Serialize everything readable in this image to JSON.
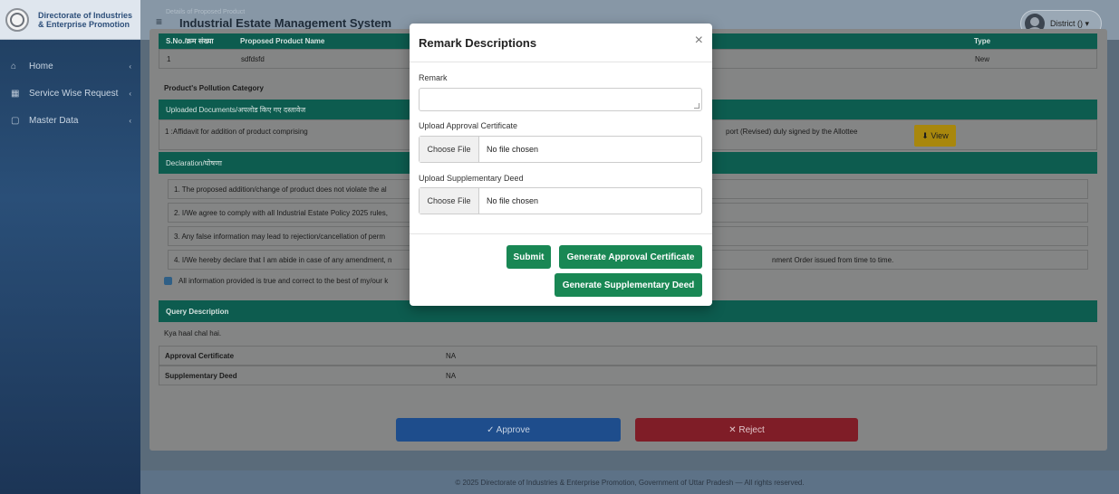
{
  "sidebar": {
    "brand_line1": "Directorate of Industries",
    "brand_line2": "& Enterprise Promotion",
    "items": [
      {
        "label": "Home",
        "icon": "home-icon"
      },
      {
        "label": "Service Wise Request",
        "icon": "list-icon"
      },
      {
        "label": "Master Data",
        "icon": "file-icon"
      }
    ]
  },
  "header": {
    "title": "Industrial Estate Management System",
    "faint_subtitle": "Details of Proposed Product",
    "user": "District () ▾"
  },
  "page": {
    "product_table": {
      "headers": [
        "S.No./क्रम संख्या",
        "Proposed Product Name",
        "Type"
      ],
      "row": [
        "1",
        "sdfdsfd",
        "New"
      ]
    },
    "pollution_label": "Product's Pollution Category",
    "uploaded_docs_header": "Uploaded Documents/अपलोड किए गए दस्तावेज",
    "doc_1": "1 :Affidavit for addition of product comprising",
    "doc_2": "port (Revised) duly signed by the Allottee",
    "view_label": "View",
    "declaration_header": "Declaration/घोषणा",
    "declarations": [
      "1. The proposed addition/change of product does not violate the al",
      "2. I/We agree to comply with all Industrial Estate Policy 2025 rules,",
      "3. Any false information may lead to rejection/cancellation of perm",
      "4. I/We hereby declare that I am abide in case of any amendment, n"
    ],
    "declaration_4_tail": "nment Order issued from time to time.",
    "confirm_text": "All information provided is true and correct to the best of my/our k",
    "query_header": "Query Description",
    "query_text": "Kya haal chal hai.",
    "approval_certificate_label": "Approval Certificate",
    "approval_certificate_value": "NA",
    "supplementary_deed_label": "Supplementary Deed",
    "supplementary_deed_value": "NA",
    "approve_label": "✓ Approve",
    "reject_label": "✕ Reject"
  },
  "modal": {
    "title": "Remark Descriptions",
    "remark_label": "Remark",
    "upload_approval_label": "Upload Approval Certificate",
    "upload_deed_label": "Upload Supplementary Deed",
    "choose_file": "Choose File",
    "no_file": "No file chosen",
    "submit": "Submit",
    "generate_approval": "Generate Approval Certificate",
    "generate_deed": "Generate Supplementary Deed"
  },
  "footer": "© 2025 Directorate of Industries & Enterprise Promotion, Government of Uttar Pradesh — All rights reserved.",
  "colors": {
    "primary_green": "#198754",
    "teal_header": "#0d5c4f",
    "approve_blue": "#1e4d8c",
    "reject_red": "#7f1d27",
    "view_yellow": "#a8870d"
  }
}
